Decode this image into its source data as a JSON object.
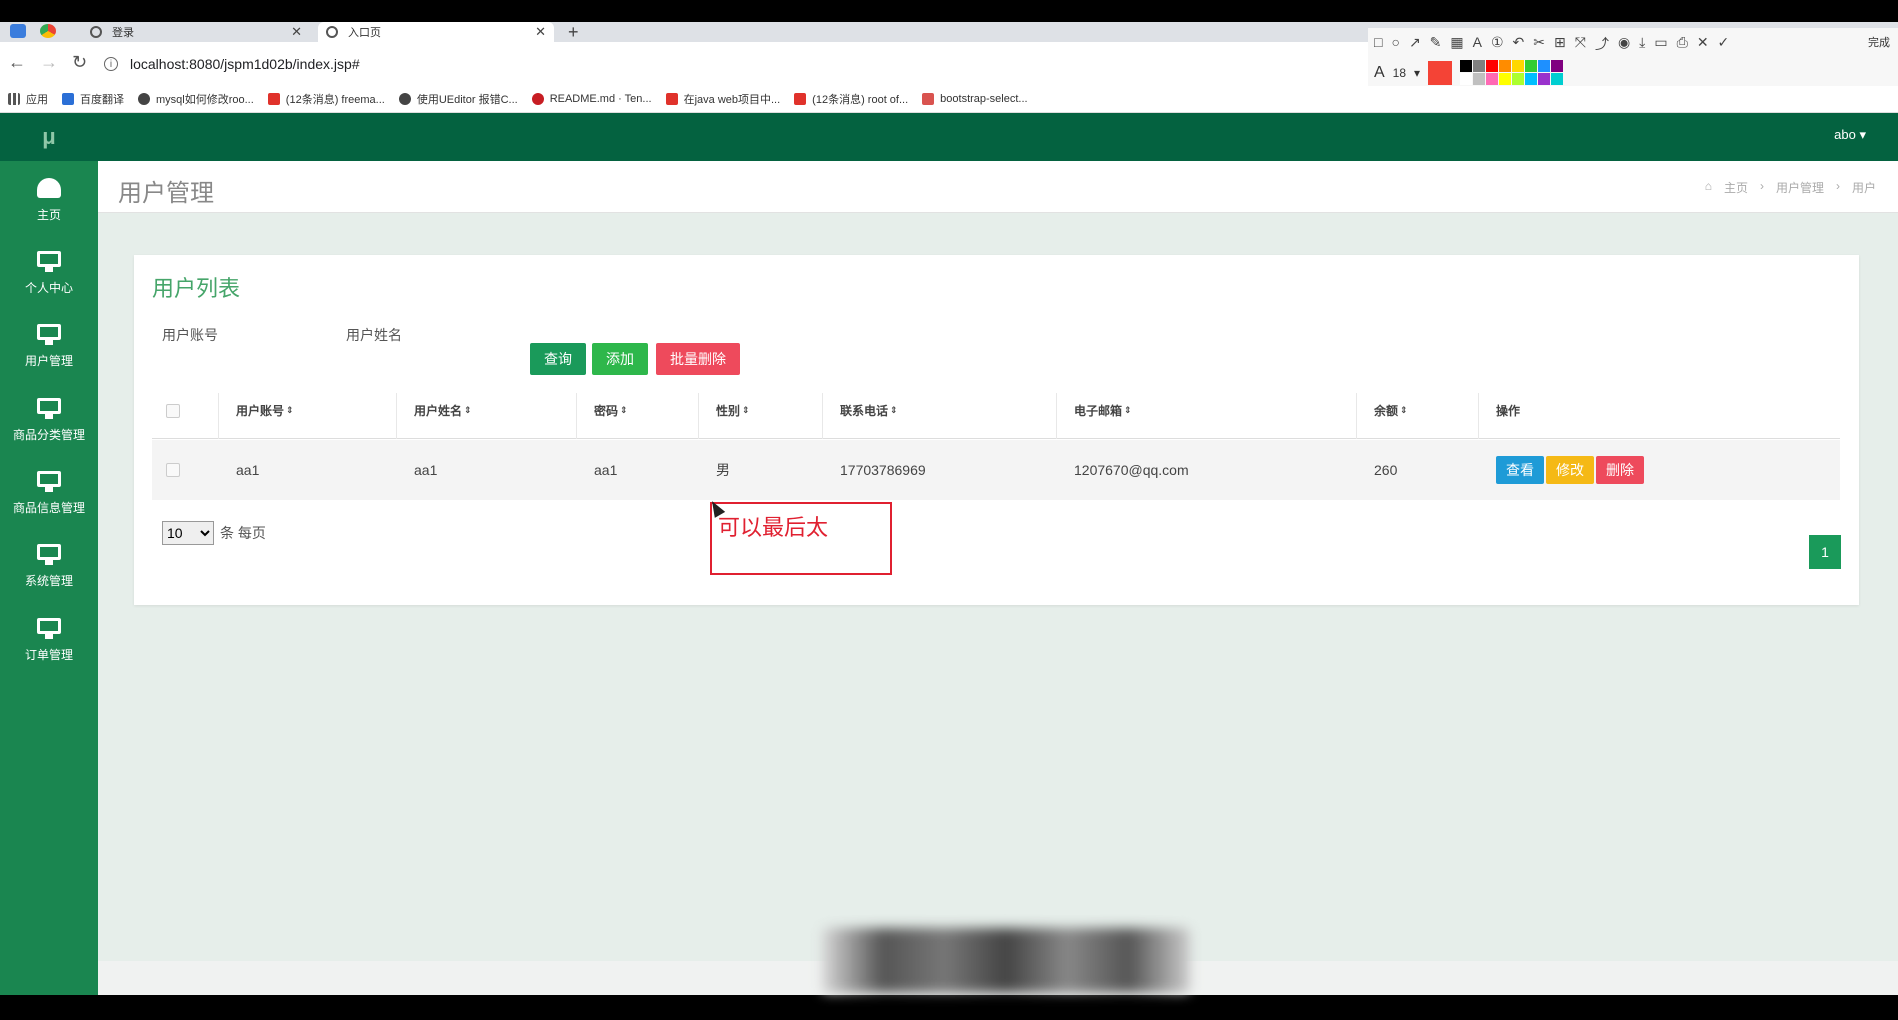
{
  "browser": {
    "tabs": [
      {
        "label": "登录",
        "active": false
      },
      {
        "label": "入口页",
        "active": true
      }
    ],
    "url": "localhost:8080/jspm1d02b/index.jsp#",
    "bookmarks": [
      {
        "label": "应用",
        "icon": "apps-grid-icon"
      },
      {
        "label": "百度翻译",
        "icon": "baidu-translate-icon"
      },
      {
        "label": "mysql如何修改roo...",
        "icon": "paw-icon"
      },
      {
        "label": "(12条消息) freema...",
        "icon": "csdn-icon"
      },
      {
        "label": "使用UEditor 报错C...",
        "icon": "paw-icon"
      },
      {
        "label": "README.md · Ten...",
        "icon": "gitee-icon"
      },
      {
        "label": "在java web项目中...",
        "icon": "csdn-icon"
      },
      {
        "label": "(12条消息) root of...",
        "icon": "csdn-icon"
      },
      {
        "label": "bootstrap-select...",
        "icon": "bookmark-icon"
      }
    ],
    "annot_toolbar": {
      "font_size": "18",
      "done_label": "完成",
      "active_color": "#f44336",
      "palette": [
        "#000000",
        "#808080",
        "#ff0000",
        "#ff8c00",
        "#ffd700",
        "#32cd32",
        "#1e90ff",
        "#800080",
        "#ffffff",
        "#c0c0c0",
        "#ff69b4",
        "#ffff00",
        "#adff2f",
        "#00bfff",
        "#9932cc",
        "#00ced1"
      ]
    }
  },
  "app": {
    "logo": "μ",
    "user": "abo ▾",
    "accent": "#046240",
    "sidebar": [
      {
        "label": "主页",
        "icon": "dashboard-icon"
      },
      {
        "label": "个人中心",
        "icon": "monitor-icon"
      },
      {
        "label": "用户管理",
        "icon": "monitor-icon"
      },
      {
        "label": "商品分类管理",
        "icon": "monitor-icon"
      },
      {
        "label": "商品信息管理",
        "icon": "monitor-icon"
      },
      {
        "label": "系统管理",
        "icon": "monitor-icon"
      },
      {
        "label": "订单管理",
        "icon": "monitor-icon"
      }
    ],
    "page_title": "用户管理",
    "breadcrumb": [
      "主页",
      "›",
      "用户管理",
      "›",
      "用户"
    ],
    "card": {
      "title": "用户列表",
      "search_labels": [
        "用户账号",
        "用户姓名"
      ],
      "buttons": {
        "query": "查询",
        "add": "添加",
        "batch_delete": "批量删除"
      },
      "columns": [
        "用户账号",
        "用户姓名",
        "密码",
        "性别",
        "联系电话",
        "电子邮箱",
        "余额",
        "操作"
      ],
      "sort_glyph": "⇕",
      "rows": [
        {
          "account": "aa1",
          "name": "aa1",
          "password": "aa1",
          "gender": "男",
          "phone": "17703786969",
          "email": "1207670@qq.com",
          "balance": "260"
        }
      ],
      "row_actions": {
        "view": "查看",
        "edit": "修改",
        "delete": "删除"
      },
      "page_size": "10",
      "page_size_suffix": "条 每页",
      "current_page": "1"
    },
    "annotation_text": "可以最后太"
  }
}
